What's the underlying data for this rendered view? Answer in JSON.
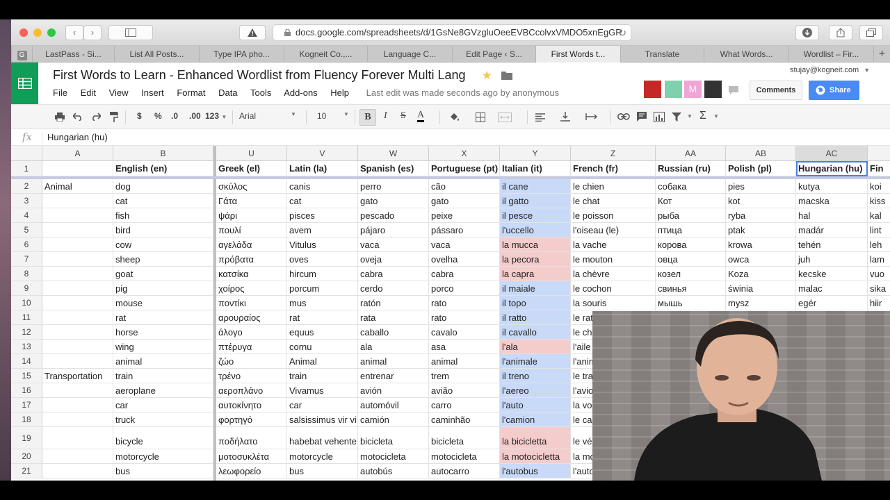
{
  "browser": {
    "url": "docs.google.com/spreadsheets/d/1GsNe8GVzgluOeeEVBCcolvxVMDO5xnEgGR",
    "tabs": [
      "LastPass - Si...",
      "List All Posts...",
      "Type IPA pho...",
      "Kogneit Co.,...",
      "Language C...",
      "Edit Page ‹ S...",
      "First Words t...",
      "Translate",
      "What Words...",
      "Wordlist – Fir..."
    ],
    "active_tab_index": 6,
    "new_tab_label": "+"
  },
  "doc": {
    "title": "First Words to Learn - Enhanced Wordlist from Fluency Forever Multi Lang",
    "menu": [
      "File",
      "Edit",
      "View",
      "Insert",
      "Format",
      "Data",
      "Tools",
      "Add-ons",
      "Help"
    ],
    "last_edit": "Last edit was made seconds ago by anonymous",
    "user_email": "stujay@kogneit.com",
    "comments_label": "Comments",
    "share_label": "Share"
  },
  "toolbar": {
    "currency": "$",
    "percent": "%",
    "dec_decrease": ".0",
    "dec_increase": ".00",
    "number_format": "123",
    "font": "Arial",
    "font_size": "10",
    "bold": "B",
    "italic": "I",
    "strike": "S",
    "text_color": "A",
    "sum": "Σ"
  },
  "formula": {
    "fx": "fx",
    "value": "Hungarian (hu)"
  },
  "grid": {
    "columns": [
      "A",
      "B",
      "U",
      "V",
      "W",
      "X",
      "Y",
      "Z",
      "AA",
      "AB",
      "AC",
      ""
    ],
    "selected_column": 10,
    "header_row": [
      "",
      "English (en)",
      "Greek (el)",
      "Latin (la)",
      "Spanish (es)",
      "Portuguese (pt)",
      "Italian (it)",
      "French (fr)",
      "Russian (ru)",
      "Polish (pl)",
      "Hungarian (hu)",
      "Fin"
    ],
    "rows": [
      {
        "n": "2",
        "cells": [
          "Animal",
          "dog",
          "σκύλος",
          "canis",
          "perro",
          "cão",
          "il cane",
          "le chien",
          "собака",
          "pies",
          "kutya",
          "koi"
        ],
        "it": "blue"
      },
      {
        "n": "3",
        "cells": [
          "",
          "cat",
          "Γάτα",
          "cat",
          "gato",
          "gato",
          "il gatto",
          "le chat",
          "Кот",
          "kot",
          "macska",
          "kiss"
        ],
        "it": "blue"
      },
      {
        "n": "4",
        "cells": [
          "",
          "fish",
          "ψάρι",
          "pisces",
          "pescado",
          "peixe",
          "il pesce",
          "le poisson",
          "рыба",
          "ryba",
          "hal",
          "kal"
        ],
        "it": "blue"
      },
      {
        "n": "5",
        "cells": [
          "",
          "bird",
          "πουλί",
          "avem",
          "pájaro",
          "pássaro",
          "l'uccello",
          "l'oiseau (le)",
          "птица",
          "ptak",
          "madár",
          "lint"
        ],
        "it": "blue"
      },
      {
        "n": "6",
        "cells": [
          "",
          "cow",
          "αγελάδα",
          "Vitulus",
          "vaca",
          "vaca",
          "la mucca",
          "la vache",
          "корова",
          "krowa",
          "tehén",
          "leh"
        ],
        "it": "pink"
      },
      {
        "n": "7",
        "cells": [
          "",
          "sheep",
          "πρόβατα",
          "oves",
          "oveja",
          "ovelha",
          "la pecora",
          "le mouton",
          "овца",
          "owca",
          "juh",
          "lam"
        ],
        "it": "pink"
      },
      {
        "n": "8",
        "cells": [
          "",
          "goat",
          "κατσίκα",
          "hircum",
          "cabra",
          "cabra",
          "la capra",
          "la chèvre",
          "козел",
          "Koza",
          "kecske",
          "vuo"
        ],
        "it": "pink"
      },
      {
        "n": "9",
        "cells": [
          "",
          "pig",
          "χοίρος",
          "porcum",
          "cerdo",
          "porco",
          "il maiale",
          "le cochon",
          "свинья",
          "świnia",
          "malac",
          "sika"
        ],
        "it": "blue"
      },
      {
        "n": "10",
        "cells": [
          "",
          "mouse",
          "ποντίκι",
          "mus",
          "ratón",
          "rato",
          "il topo",
          "la souris",
          "мышь",
          "mysz",
          "egér",
          "hiir"
        ],
        "it": "blue"
      },
      {
        "n": "11",
        "cells": [
          "",
          "rat",
          "αρουραίος",
          "rat",
          "rata",
          "rato",
          "il ratto",
          "le rat",
          "",
          "",
          "",
          ""
        ],
        "it": "blue"
      },
      {
        "n": "12",
        "cells": [
          "",
          "horse",
          "άλογο",
          "equus",
          "caballo",
          "cavalo",
          "il cavallo",
          "le ch",
          "",
          "",
          "",
          ""
        ],
        "it": "blue"
      },
      {
        "n": "13",
        "cells": [
          "",
          "wing",
          "πτέρυγα",
          "cornu",
          "ala",
          "asa",
          "l'ala",
          "l'aile",
          "",
          "",
          "",
          ""
        ],
        "it": "pink"
      },
      {
        "n": "14",
        "cells": [
          "",
          "animal",
          "ζώο",
          "Animal",
          "animal",
          "animal",
          "l'animale",
          "l'anim",
          "",
          "",
          "",
          ""
        ],
        "it": "blue"
      },
      {
        "n": "15",
        "cells": [
          "Transportation",
          "train",
          "τρένο",
          "train",
          "entrenar",
          "trem",
          "il treno",
          "le tra",
          "",
          "",
          "",
          ""
        ],
        "it": "blue"
      },
      {
        "n": "16",
        "cells": [
          "",
          "aeroplane",
          "αεροπλάνο",
          "Vivamus",
          "avión",
          "avião",
          "l'aereo",
          "l'avio",
          "",
          "",
          "",
          ""
        ],
        "it": "blue"
      },
      {
        "n": "17",
        "cells": [
          "",
          "car",
          "αυτοκίνητο",
          "car",
          "automóvil",
          "carro",
          "l'auto",
          "la vo",
          "",
          "",
          "",
          ""
        ],
        "it": "blue"
      },
      {
        "n": "18",
        "cells": [
          "",
          "truck",
          "φορτηγό",
          "salsissimus vir vi",
          "camión",
          "caminhão",
          "l'camion",
          "le ca",
          "",
          "",
          "",
          ""
        ],
        "it": "blue"
      },
      {
        "n": "19",
        "cells": [
          "",
          "bicycle",
          "ποδήλατο",
          "habebat vehente",
          "bicicleta",
          "bicicleta",
          "la bicicletta",
          "le vé",
          "",
          "",
          "",
          ""
        ],
        "it": "pink"
      },
      {
        "n": "20",
        "cells": [
          "",
          "motorcycle",
          "μοτοσυκλέτα",
          "motorcycle",
          "motocicleta",
          "motocicleta",
          "la motocicletta",
          "la mo",
          "",
          "",
          "",
          ""
        ],
        "it": "pink"
      },
      {
        "n": "21",
        "cells": [
          "",
          "bus",
          "λεωφορείο",
          "bus",
          "autobús",
          "autocarro",
          "l'autobus",
          "l'auto",
          "",
          "",
          "",
          ""
        ],
        "it": "blue"
      }
    ]
  },
  "colors": {
    "sheets_green": "#0f9d58",
    "share_blue": "#4a8af4",
    "italian_blue": "#c9daf8",
    "italian_pink": "#f4cccc",
    "selection": "#4a7de8"
  }
}
